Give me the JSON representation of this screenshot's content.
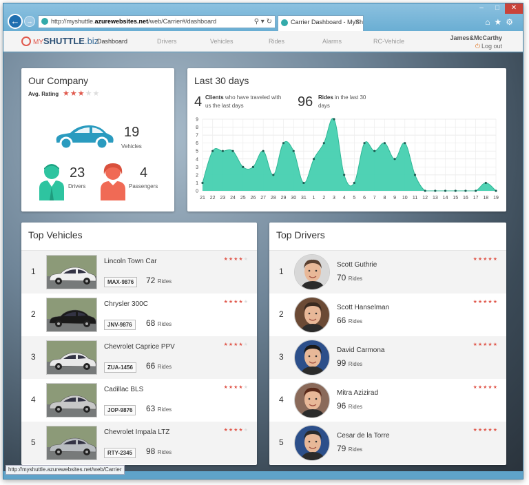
{
  "browser": {
    "url_prefix": "http://myshuttle.",
    "url_host": "azurewebsites.net",
    "url_path": "/web/Carrier#/dashboard",
    "tab_title": "Carrier Dashboard - MyShu...",
    "status_url": "http://myshuttle.azurewebsites.net/web/Carrier"
  },
  "nav": {
    "logo_light": "MY",
    "logo_bold": "SHUTTLE",
    "logo_suffix": ".biz",
    "items": [
      "Dashboard",
      "Drivers",
      "Vehicles",
      "Rides",
      "Alarms",
      "RC-Vehicle"
    ],
    "user": "James&McCarthy",
    "logout": "Log out"
  },
  "company": {
    "title": "Our Company",
    "rating_label": "Avg. Rating",
    "rating": 3,
    "rating_max": 5,
    "vehicles": "19",
    "vehicles_label": "Vehicles",
    "drivers": "23",
    "drivers_label": "Drivers",
    "passengers": "4",
    "passengers_label": "Passengers"
  },
  "last30": {
    "title": "Last 30 days",
    "clients_num": "4",
    "clients_bold": "Clients",
    "clients_text": " who have traveled with us the last days",
    "rides_num": "96",
    "rides_bold": "Rides",
    "rides_text": " in the last 30 days"
  },
  "chart_data": {
    "type": "area",
    "x": [
      "21",
      "22",
      "23",
      "24",
      "25",
      "26",
      "27",
      "28",
      "29",
      "30",
      "31",
      "1",
      "2",
      "3",
      "4",
      "5",
      "6",
      "7",
      "8",
      "9",
      "10",
      "11",
      "12",
      "13",
      "14",
      "15",
      "16",
      "17",
      "18",
      "19"
    ],
    "values": [
      1,
      5,
      5,
      5,
      3,
      3,
      5,
      2,
      6,
      5,
      1,
      4,
      6,
      9,
      2,
      1,
      6,
      5,
      6,
      4,
      6,
      2,
      0,
      0,
      0,
      0,
      0,
      0,
      1,
      0
    ],
    "ylim": [
      0,
      9
    ],
    "yticks": [
      0,
      1,
      2,
      3,
      4,
      5,
      6,
      7,
      8,
      9
    ],
    "grid": true,
    "color": "#46d0b0"
  },
  "top_vehicles": {
    "title": "Top Vehicles",
    "rides_unit": "Rides",
    "items": [
      {
        "rank": "1",
        "name": "Lincoln Town Car",
        "plate": "MAX-9876",
        "rides": "72",
        "stars": 4,
        "color": "#f0f0f0"
      },
      {
        "rank": "2",
        "name": "Chrysler 300C",
        "plate": "JNV-9876",
        "rides": "68",
        "stars": 4,
        "color": "#1a1a1a"
      },
      {
        "rank": "3",
        "name": "Chevrolet Caprice PPV",
        "plate": "ZUA-1456",
        "rides": "66",
        "stars": 4,
        "color": "#e8e8e8"
      },
      {
        "rank": "4",
        "name": "Cadillac BLS",
        "plate": "JOP-9876",
        "rides": "63",
        "stars": 4,
        "color": "#c8c8c8"
      },
      {
        "rank": "5",
        "name": "Chevrolet Impala LTZ",
        "plate": "RTY-2345",
        "rides": "98",
        "stars": 4,
        "color": "#b8bcc0"
      }
    ]
  },
  "top_drivers": {
    "title": "Top Drivers",
    "rides_unit": "Rides",
    "items": [
      {
        "rank": "1",
        "name": "Scott Guthrie",
        "rides": "70",
        "stars": 5,
        "hair": "#5a4030",
        "bg": "#d8d8d8"
      },
      {
        "rank": "2",
        "name": "Scott Hanselman",
        "rides": "66",
        "stars": 5,
        "hair": "#3a2a20",
        "bg": "#6b4a35"
      },
      {
        "rank": "3",
        "name": "David Carmona",
        "rides": "99",
        "stars": 5,
        "hair": "#1a1a1a",
        "bg": "#2c4f8a"
      },
      {
        "rank": "4",
        "name": "Mitra Azizirad",
        "rides": "96",
        "stars": 5,
        "hair": "#5a2a1a",
        "bg": "#8a6a5a"
      },
      {
        "rank": "5",
        "name": "Cesar de la Torre",
        "rides": "79",
        "stars": 5,
        "hair": "#2a2a2a",
        "bg": "#2c4f8a"
      }
    ]
  }
}
